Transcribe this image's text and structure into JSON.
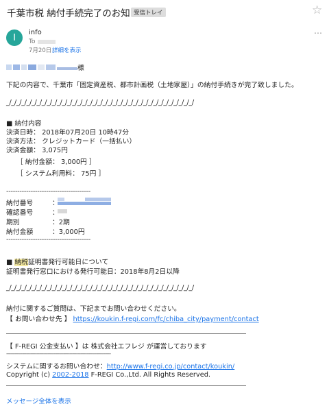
{
  "header": {
    "subject": "千葉市税 納付手続完了のお知らせ",
    "label_badge": "受信トレイ"
  },
  "sender": {
    "avatar_letter": "I",
    "name": "info",
    "to_prefix": "To",
    "date": "7月20日",
    "details_link": "詳細を表示"
  },
  "body": {
    "salutation_suffix": "様",
    "intro": "下記の内容で、千葉市「固定資産税、都市計画税（土地家屋）」の納付手続きが完了致しました。",
    "separator1": "_/_/_/_/_/_/_/_/_/_/_/_/_/_/_/_/_/_/_/_/_/_/_/_/_/_/_/_/_/_/_/_/_/_/_/_/_/",
    "payment_heading": "■ 納付内容",
    "settlement_datetime": "決済日時： 2018年07月20日 10時47分",
    "payment_method": "決済方法： クレジットカード（一括払い）",
    "settlement_amount": "決済金額： 3,075円",
    "payment_amount_detail": "［ 納付金額： 3,000円 ］",
    "system_fee_detail": "［ システム利用料： 75円 ］",
    "dash_line1": "--------------------------------------",
    "fields": [
      {
        "label": "納付番号",
        "value": "："
      },
      {
        "label": "確認番号",
        "value": "："
      },
      {
        "label": "期別",
        "value": "：2期"
      },
      {
        "label": "納付金額",
        "value": "：3,000円"
      }
    ],
    "dash_line2": "--------------------------------------",
    "cert_heading_prefix": "■ ",
    "cert_heading_highlight": "納税",
    "cert_heading_rest": "証明書発行可能日について",
    "cert_date": "証明書発行窓口における発行可能日：2018年8月2日以降",
    "separator2": "_/_/_/_/_/_/_/_/_/_/_/_/_/_/_/_/_/_/_/_/_/_/_/_/_/_/_/_/_/_/_/_/_/_/_/_/_/",
    "inquiry_text": "納付に関するご質問は、下記までお問い合わせください。",
    "contact_prefix": "【 お問い合わせ先 】",
    "contact_url": "https://koukin.f-regi.com/fc/chiba_city/payment/contact",
    "operator_note": "【 F-REGI 公金支払い 】は 株式会社エフレジ が運営しております",
    "dash_line3": "-------------------------------------------------------------------------",
    "system_inquiry_prefix": "システムに関するお問い合わせ：",
    "system_inquiry_url": "http://www.f-regi.co.jp/contact/koukin/",
    "copyright_prefix": "Copyright (c) ",
    "copyright_years": "2002-2018",
    "copyright_rest": " F-REGI Co.,Ltd. All Rights Reserved."
  },
  "footer": {
    "show_full_message": "メッセージ全体を表示"
  }
}
